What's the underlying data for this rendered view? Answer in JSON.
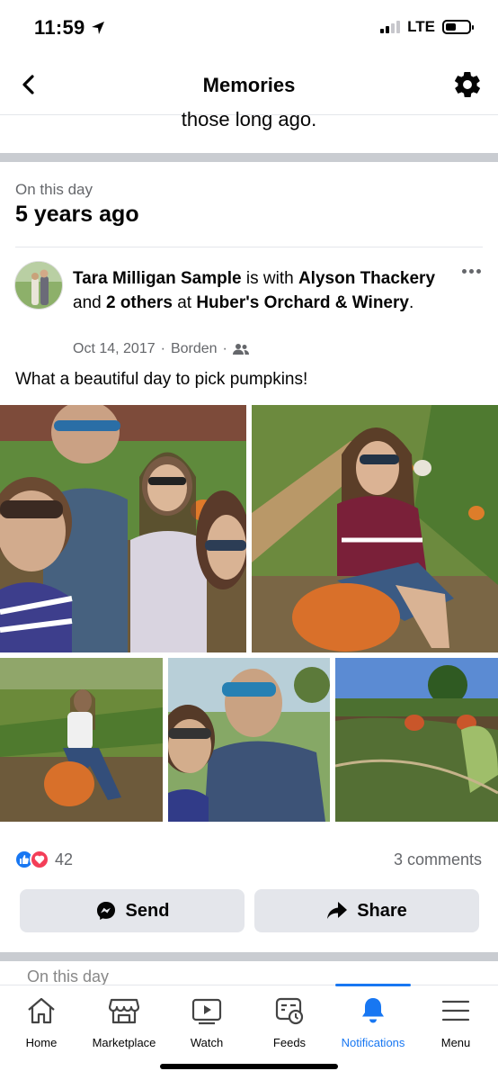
{
  "status": {
    "time": "11:59",
    "network": "LTE"
  },
  "nav": {
    "title": "Memories"
  },
  "previous_card": {
    "text": "those long ago."
  },
  "section": {
    "label": "On this day",
    "title": "5 years ago"
  },
  "post": {
    "author": "Tara Milligan Sample",
    "is_with": "is with",
    "tagged": "Alyson Thackery",
    "and": "and",
    "others": "2 others",
    "at": "at",
    "place": "Huber's Orchard & Winery",
    "period": ".",
    "date": "Oct 14, 2017",
    "location": "Borden",
    "text": "What a beautiful day to pick pumpkins!",
    "reaction_count": "42",
    "comments": "3 comments"
  },
  "actions": {
    "send": "Send",
    "share": "Share"
  },
  "tabs": [
    {
      "label": "Home",
      "icon": "home-icon"
    },
    {
      "label": "Marketplace",
      "icon": "marketplace-icon"
    },
    {
      "label": "Watch",
      "icon": "watch-icon"
    },
    {
      "label": "Feeds",
      "icon": "feeds-icon"
    },
    {
      "label": "Notifications",
      "icon": "bell-icon",
      "active": true
    },
    {
      "label": "Menu",
      "icon": "menu-icon"
    }
  ],
  "next_card_peek": "On this day",
  "colors": {
    "accent": "#1877f2",
    "love": "#f33e58",
    "divider": "#c9ccd1",
    "muted": "#65676b"
  }
}
